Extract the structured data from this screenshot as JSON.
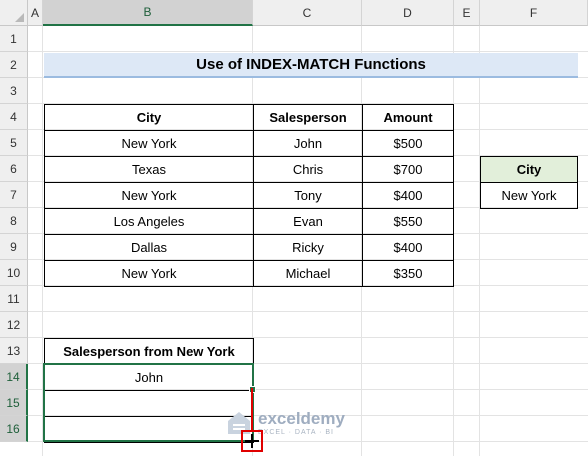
{
  "sheet": {
    "columns": [
      "A",
      "B",
      "C",
      "D",
      "E",
      "F"
    ],
    "rows": [
      "1",
      "2",
      "3",
      "4",
      "5",
      "6",
      "7",
      "8",
      "9",
      "10",
      "11",
      "12",
      "13",
      "14",
      "15",
      "16"
    ],
    "selected_column": "B",
    "selected_rows": [
      "14",
      "15",
      "16"
    ]
  },
  "title": "Use of INDEX-MATCH Functions",
  "table": {
    "headers": [
      "City",
      "Salesperson",
      "Amount"
    ],
    "rows": [
      [
        "New York",
        "John",
        "$500"
      ],
      [
        "Texas",
        "Chris",
        "$700"
      ],
      [
        "New York",
        "Tony",
        "$400"
      ],
      [
        "Los Angeles",
        "Evan",
        "$550"
      ],
      [
        "Dallas",
        "Ricky",
        "$400"
      ],
      [
        "New York",
        "Michael",
        "$350"
      ]
    ]
  },
  "lookup": {
    "header": "City",
    "value": "New York"
  },
  "result": {
    "header": "Salesperson from New York",
    "values": [
      "John",
      "",
      ""
    ]
  },
  "watermark": {
    "name": "exceldemy",
    "tagline": "EXCEL · DATA · BI"
  },
  "colors": {
    "selection": "#217346",
    "title_fill": "#dde8f6",
    "lookup_header_fill": "#e2efda",
    "highlight": "#e00000"
  }
}
